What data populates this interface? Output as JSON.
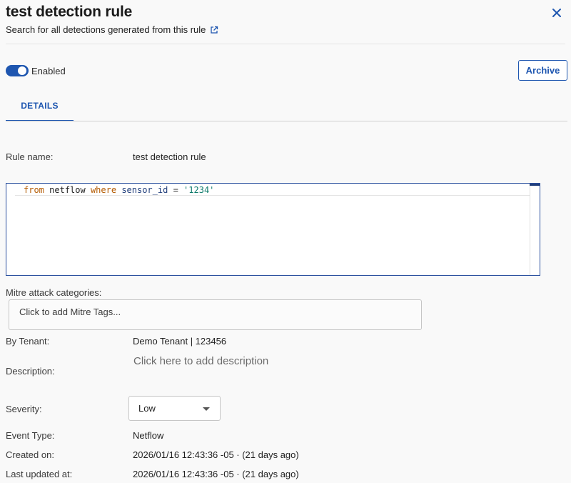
{
  "header": {
    "title": "test detection rule",
    "subtitle": "Search for all detections generated from this rule"
  },
  "controls": {
    "enabled_label": "Enabled",
    "enabled": true,
    "archive_label": "Archive"
  },
  "tabs": [
    {
      "label": "DETAILS",
      "active": true
    }
  ],
  "details": {
    "rule_name_label": "Rule name:",
    "rule_name_value": "test detection rule",
    "query": {
      "kw_from": "from",
      "table": "netflow",
      "kw_where": "where",
      "field": "sensor_id",
      "op": "=",
      "value": "'1234'"
    },
    "mitre_label": "Mitre attack categories:",
    "mitre_placeholder": "Click to add Mitre Tags...",
    "tenant_label": "By Tenant:",
    "tenant_value": "Demo Tenant | 123456",
    "description_label": "Description:",
    "description_placeholder": "Click here to add description",
    "severity_label": "Severity:",
    "severity_value": "Low",
    "event_type_label": "Event Type:",
    "event_type_value": "Netflow",
    "created_label": "Created on:",
    "created_value": "2026/01/16 12:43:36 -05 · (21 days ago)",
    "updated_label": "Last updated at:",
    "updated_value": "2026/01/16 12:43:36 -05 · (21 days ago)"
  },
  "colors": {
    "accent": "#1e56b0",
    "keyword": "#b35a00",
    "string": "#0c7a6a"
  }
}
